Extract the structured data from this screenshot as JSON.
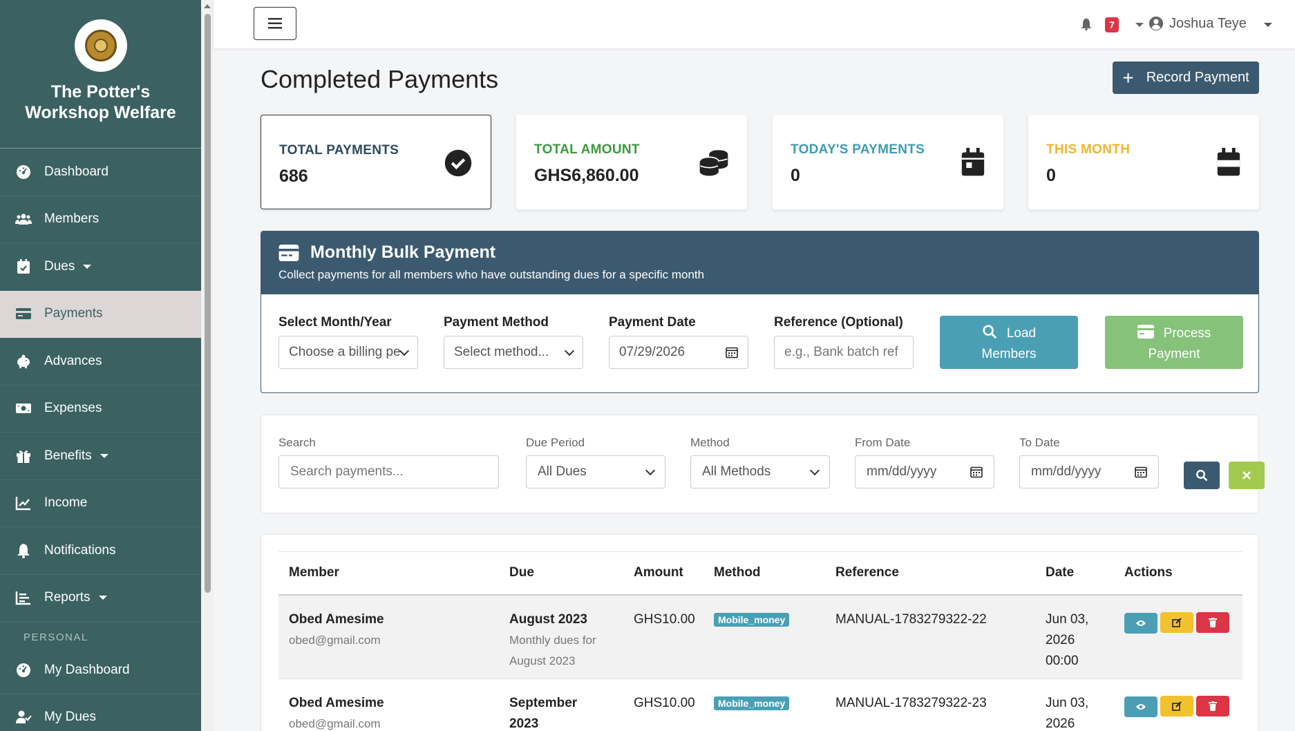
{
  "brand": {
    "title_line1": "The Potter's",
    "title_line2": "Workshop Welfare"
  },
  "sidebar": {
    "items": [
      {
        "label": "Dashboard",
        "icon": "gauge-icon"
      },
      {
        "label": "Members",
        "icon": "users-icon"
      },
      {
        "label": "Dues",
        "icon": "calendar-check-icon",
        "dropdown": true
      },
      {
        "label": "Payments",
        "icon": "credit-card-icon",
        "active": true
      },
      {
        "label": "Advances",
        "icon": "piggy-bank-icon"
      },
      {
        "label": "Expenses",
        "icon": "money-bill-icon"
      },
      {
        "label": "Benefits",
        "icon": "gift-icon",
        "dropdown": true
      },
      {
        "label": "Income",
        "icon": "chart-line-icon"
      },
      {
        "label": "Notifications",
        "icon": "bell-icon"
      },
      {
        "label": "Reports",
        "icon": "list-chart-icon",
        "dropdown": true
      }
    ],
    "section_personal": "PERSONAL",
    "personal_items": [
      {
        "label": "My Dashboard",
        "icon": "gauge-icon"
      },
      {
        "label": "My Dues",
        "icon": "user-check-icon"
      }
    ]
  },
  "topbar": {
    "notification_count": "7",
    "user_name": "Joshua Teye"
  },
  "page": {
    "title": "Completed Payments",
    "record_button": "Record Payment"
  },
  "stats": [
    {
      "label": "TOTAL PAYMENTS",
      "value": "686",
      "color": "#2d4a5c",
      "icon": "check-circle-icon"
    },
    {
      "label": "TOTAL AMOUNT",
      "value": "GHS6,860.00",
      "color": "#3b9a3b",
      "icon": "coins-icon"
    },
    {
      "label": "TODAY'S PAYMENTS",
      "value": "0",
      "color": "#3f9bb5",
      "icon": "calendar-day-icon"
    },
    {
      "label": "THIS MONTH",
      "value": "0",
      "color": "#f2b52e",
      "icon": "calendar-icon"
    }
  ],
  "bulk": {
    "title": "Monthly Bulk Payment",
    "subtitle": "Collect payments for all members who have outstanding dues for a specific month",
    "month_label": "Select Month/Year",
    "month_value": "Choose a billing pe",
    "method_label": "Payment Method",
    "method_value": "Select method...",
    "date_label": "Payment Date",
    "date_value": "07/29/2026",
    "ref_label": "Reference (Optional)",
    "ref_placeholder": "e.g., Bank batch ref",
    "load_line1": "Load",
    "load_line2": "Members",
    "process_line1": "Process",
    "process_line2": "Payment"
  },
  "filters": {
    "search_label": "Search",
    "search_placeholder": "Search payments...",
    "due_label": "Due Period",
    "due_value": "All Dues",
    "method_label": "Method",
    "method_value": "All Methods",
    "from_label": "From Date",
    "from_placeholder": "mm/dd/yyyy",
    "to_label": "To Date",
    "to_placeholder": "mm/dd/yyyy"
  },
  "table": {
    "headers": [
      "Member",
      "Due",
      "Amount",
      "Method",
      "Reference",
      "Date",
      "Actions"
    ],
    "rows": [
      {
        "name": "Obed Amesime",
        "email": "obed@gmail.com",
        "due": "August 2023",
        "due_desc_1": "Monthly dues for",
        "due_desc_2": "August 2023",
        "amount": "GHS10.00",
        "method": "Mobile_money",
        "reference": "MANUAL-1783279322-22",
        "date_1": "Jun 03,",
        "date_2": "2026",
        "date_3": "00:00"
      },
      {
        "name": "Obed Amesime",
        "email": "obed@gmail.com",
        "due_1": "September",
        "due_2": "2023",
        "amount": "GHS10.00",
        "method": "Mobile_money",
        "reference": "MANUAL-1783279322-23",
        "date_1": "Jun 03,",
        "date_2": "2026"
      }
    ]
  }
}
